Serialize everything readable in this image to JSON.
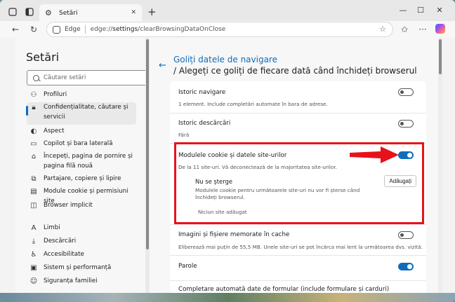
{
  "tab": {
    "title": "Setări"
  },
  "address": {
    "brand": "Edge",
    "url_prefix": "edge://",
    "url_bold": "settings",
    "url_rest": "/clearBrowsingDataOnClose"
  },
  "sidebar": {
    "title": "Setări",
    "search_placeholder": "Căutare setări",
    "items": [
      {
        "label": "Profiluri",
        "icon": "profile-icon",
        "active": false
      },
      {
        "label": "Confidențialitate, căutare și servicii",
        "icon": "lock-icon",
        "active": true
      },
      {
        "label": "Aspect",
        "icon": "appearance-icon",
        "active": false
      },
      {
        "label": "Copilot și bara laterală",
        "icon": "sidebar-icon",
        "active": false
      },
      {
        "label": "Începeți, pagina de pornire și pagina filă nouă",
        "icon": "home-icon",
        "active": false
      },
      {
        "label": "Partajare, copiere și lipire",
        "icon": "share-icon",
        "active": false
      },
      {
        "label": "Module cookie și permisiuni site",
        "icon": "cookie-icon",
        "active": false
      },
      {
        "label": "Browser implicit",
        "icon": "browser-icon",
        "active": false
      },
      {
        "label": "Limbi",
        "icon": "language-icon",
        "active": false
      },
      {
        "label": "Descărcări",
        "icon": "download-icon",
        "active": false
      },
      {
        "label": "Accesibilitate",
        "icon": "accessibility-icon",
        "active": false
      },
      {
        "label": "Sistem și performanță",
        "icon": "performance-icon",
        "active": false
      },
      {
        "label": "Siguranța familiei",
        "icon": "family-icon",
        "active": false
      }
    ]
  },
  "main": {
    "breadcrumb": "Goliți datele de navigare",
    "title": "/ Alegeți ce goliți de fiecare dată când închideți browserul",
    "rows": [
      {
        "title": "Istoric navigare",
        "desc": "1 element. Include completări automate în bara de adrese.",
        "on": false
      },
      {
        "title": "Istoric descărcări",
        "desc": "Fără",
        "on": false
      },
      {
        "title": "Modulele cookie și datele site-urilor",
        "desc": "De la 11 site-uri. Vă deconectează de la majoritatea site-urilor.",
        "on": true
      },
      {
        "title": "Imagini și fișiere memorate în cache",
        "desc": "Eliberează mai puțin de 55,5 MB. Unele site-uri se pot încărca mai lent la următoarea dvs. vizită.",
        "on": false
      },
      {
        "title": "Parole",
        "desc": "",
        "on": true
      },
      {
        "title": "Completare automată date de formular (include formulare și carduri)",
        "desc": "",
        "on": false
      }
    ],
    "exceptions": {
      "title": "Nu se șterge",
      "desc": "Modulele cookie pentru următoarele site-uri nu vor fi șterse când închideți browserul.",
      "add_label": "Adăugați",
      "empty": "Niciun site adăugat"
    }
  },
  "colors": {
    "accent": "#0f6cbd",
    "highlight": "#e8121c"
  }
}
